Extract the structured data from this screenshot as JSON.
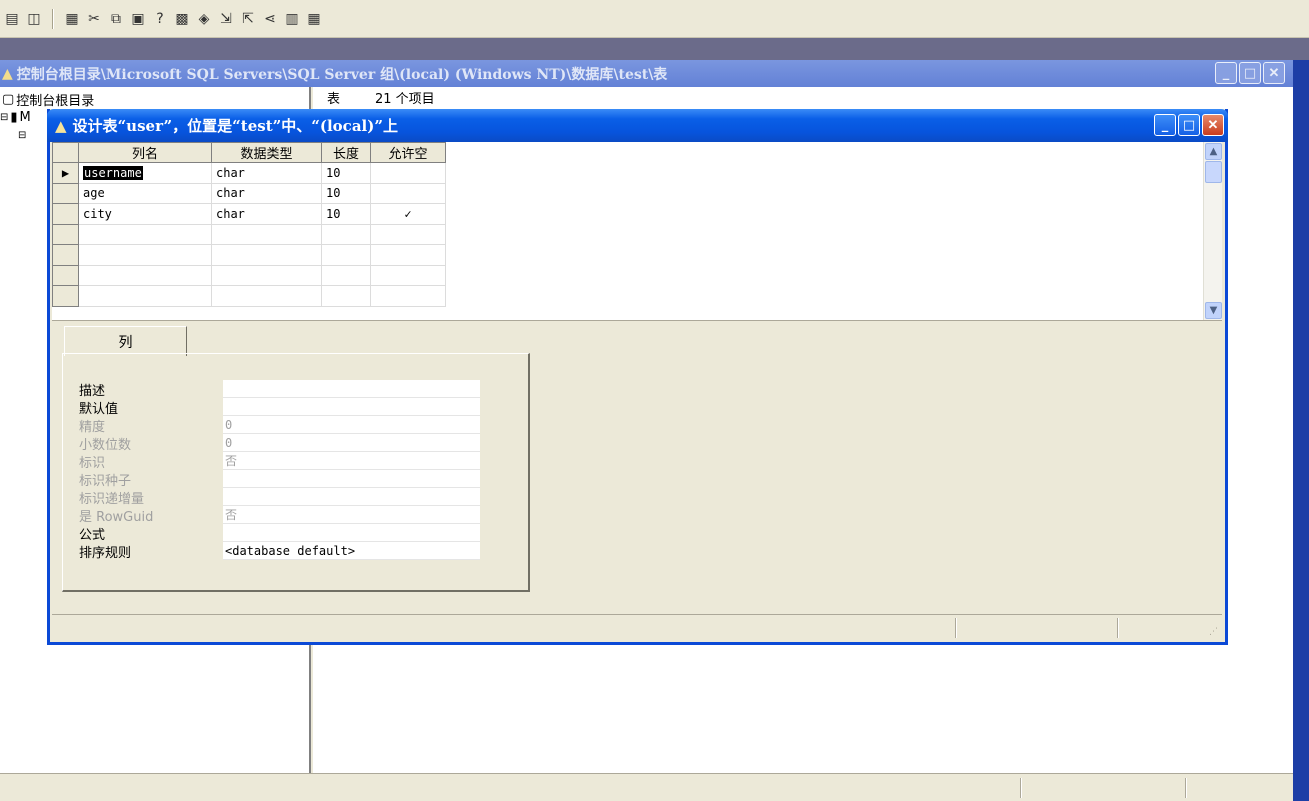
{
  "toolbar": {
    "icons": [
      "properties-icon",
      "window-icon",
      "server-icon",
      "cut-icon",
      "copy-icon",
      "paste-icon",
      "help-icon",
      "query-icon",
      "wizard-icon",
      "import-icon",
      "export-icon",
      "relationship-icon",
      "replication-icon",
      "grid-icon"
    ]
  },
  "mdi": {
    "title": "控制台根目录\\Microsoft SQL Servers\\SQL Server 组\\(local) (Windows NT)\\数据库\\test\\表",
    "tree_root": "控制台根目录",
    "tree_node": "M",
    "list_col1": "表",
    "list_count": "21 个项目"
  },
  "dialog": {
    "title": "设计表“user”，位置是“test”中、“(local)”上",
    "columns": [
      "列名",
      "数据类型",
      "长度",
      "允许空"
    ],
    "rows": [
      {
        "name": "username",
        "type": "char",
        "length": "10",
        "nullable": ""
      },
      {
        "name": "age",
        "type": "char",
        "length": "10",
        "nullable": ""
      },
      {
        "name": "city",
        "type": "char",
        "length": "10",
        "nullable": "✓"
      }
    ],
    "current_row_marker": "▶",
    "tab_label": "列",
    "properties": [
      {
        "label": "描述",
        "value": "",
        "disabled": false
      },
      {
        "label": "默认值",
        "value": "",
        "disabled": false
      },
      {
        "label": "精度",
        "value": "0",
        "disabled": true
      },
      {
        "label": "小数位数",
        "value": "0",
        "disabled": true
      },
      {
        "label": "标识",
        "value": "否",
        "disabled": true
      },
      {
        "label": "标识种子",
        "value": "",
        "disabled": true
      },
      {
        "label": "标识递增量",
        "value": "",
        "disabled": true
      },
      {
        "label": "是 RowGuid",
        "value": "否",
        "disabled": true
      },
      {
        "label": "公式",
        "value": "",
        "disabled": false
      },
      {
        "label": "排序规则",
        "value": "<database default>",
        "disabled": false
      }
    ]
  },
  "colors": {
    "dialog_title": "#0a5fe7",
    "mdi_title_inactive": "#7a96df",
    "face": "#ece9d8"
  }
}
